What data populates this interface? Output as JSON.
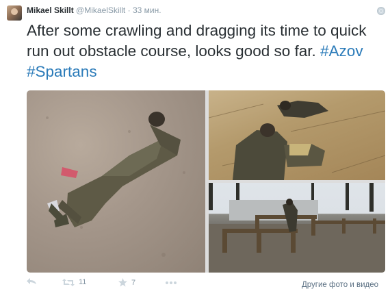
{
  "tweet": {
    "author_name": "Mikael Skillt",
    "author_handle": "@MikaelSkillt",
    "separator": "·",
    "timestamp": "33 мин.",
    "text_prefix": "After some crawling and dragging its time to quick run out obstacle course, looks good so far.",
    "hashtags": [
      "#Azov",
      "#Spartans"
    ],
    "media": [
      "photo",
      "photo",
      "photo"
    ],
    "actions": {
      "reply_icon": "reply-icon",
      "retweet_icon": "retweet-icon",
      "retweet_count": "11",
      "favorite_icon": "star-icon",
      "favorite_count": "7",
      "more_icon": "more-icon"
    },
    "more_media_label": "Другие фото и видео"
  },
  "colors": {
    "link": "#2b7bb9",
    "text": "#292f33",
    "muted": "#8899a6"
  }
}
